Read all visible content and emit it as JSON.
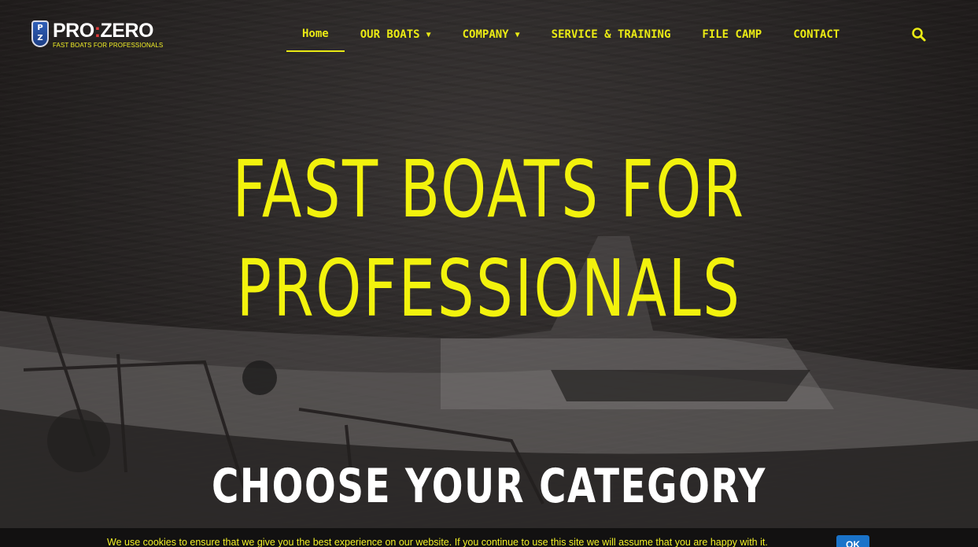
{
  "brand": {
    "shield_top": "P",
    "shield_bottom": "Z",
    "name_left": "PRO",
    "separator": ":",
    "name_right": "ZERO",
    "tagline": "FAST BOATS FOR PROFESSIONALS"
  },
  "nav": {
    "items": [
      {
        "label": "Home",
        "active": true,
        "dropdown": false
      },
      {
        "label": "OUR BOATS",
        "active": false,
        "dropdown": true
      },
      {
        "label": "COMPANY",
        "active": false,
        "dropdown": true
      },
      {
        "label": "SERVICE & TRAINING",
        "active": false,
        "dropdown": false
      },
      {
        "label": "FILE CAMP",
        "active": false,
        "dropdown": false
      },
      {
        "label": "CONTACT",
        "active": false,
        "dropdown": false
      }
    ],
    "dropdown_icon": "caret-down-icon",
    "search_icon": "search-icon"
  },
  "hero": {
    "line1": "FAST BOATS FOR",
    "line2": "PROFESSIONALS"
  },
  "section": {
    "title": "CHOOSE YOUR CATEGORY"
  },
  "cookie": {
    "text": "We use cookies to ensure that we give you the best experience on our website. If you continue to use this site we will assume that you are happy with it.",
    "ok_label": "OK"
  },
  "colors": {
    "accent": "#f2f20d",
    "nav_text": "#eaea14",
    "button": "#1a73c9"
  }
}
